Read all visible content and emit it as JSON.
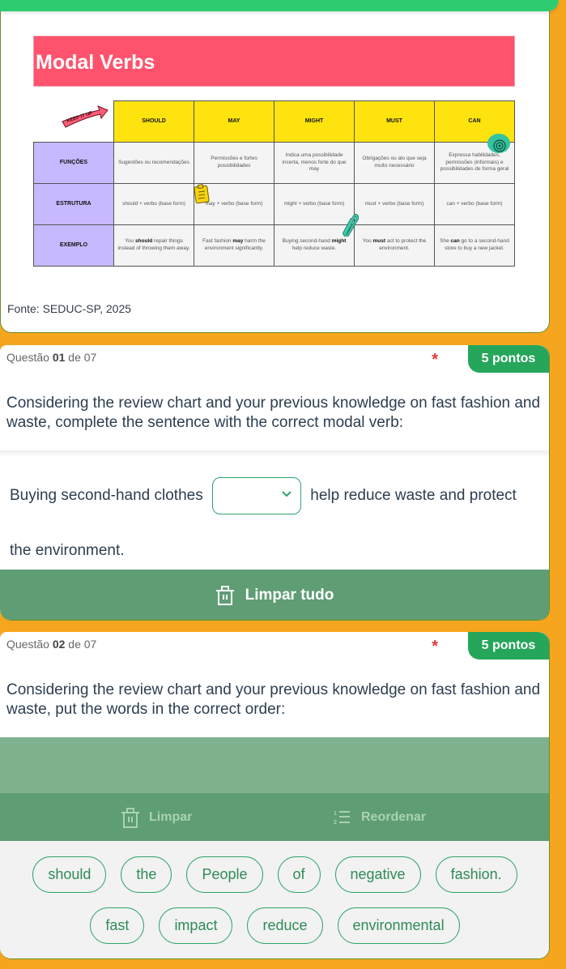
{
  "colors": {
    "page_bg": "#f5a61e",
    "top_bar": "#2ecc71",
    "banner": "#ff536d",
    "header_yellow": "#ffe30f",
    "row_header_purple": "#c8b8ff",
    "accent_green": "#26a65b",
    "button_green": "#5f9d74"
  },
  "review_card": {
    "banner_title": "Modal Verbs",
    "sticker_keep": "KEEP IT UP",
    "sticker_target": "ON TARGET",
    "table": {
      "columns": [
        "SHOULD",
        "MAY",
        "MIGHT",
        "MUST",
        "CAN"
      ],
      "rows": [
        {
          "label": "FUNÇÕES",
          "cells": [
            "Sugestões ou recomendações",
            "Permissões e fortes possibilidades",
            "Indica uma possibilidade incerta, menos forte do que may",
            "Obrigações ou alo que seja muito necessário",
            "Expressa habilidades, permissões (informais) e possibilidades de forma geral"
          ]
        },
        {
          "label": "ESTRUTURA",
          "cells": [
            "should + verbo (base form)",
            "may + verbo (base form)",
            "might + verbo (base form)",
            "must + verbo (base form)",
            "can + verbo (base form)"
          ]
        },
        {
          "label": "EXEMPLO",
          "cells": [
            {
              "pre": "You ",
              "modal": "should",
              "post": " repair things instead of throwing them away."
            },
            {
              "pre": "Fast fashion ",
              "modal": "may",
              "post": " harm the environment significantly."
            },
            {
              "pre": "Buying second-hand ",
              "modal": "might",
              "post": " help reduce waste."
            },
            {
              "pre": "You ",
              "modal": "must",
              "post": " act to protect the environment."
            },
            {
              "pre": "She ",
              "modal": "can",
              "post": " go to a second-hand store to buy a new jacket."
            }
          ]
        }
      ]
    },
    "source": "Fonte: SEDUC-SP, 2025"
  },
  "question1": {
    "label_prefix": "Questão ",
    "number": "01",
    "label_suffix": " de 07",
    "required_mark": "*",
    "points": "5 pontos",
    "prompt": "Considering the review chart and your previous knowledge on fast fashion and waste, complete the sentence with the correct modal verb:",
    "sentence_before": "Buying second-hand clothes",
    "select_value": "",
    "sentence_after": "help reduce waste and protect the environment.",
    "clear_all_label": "Limpar tudo"
  },
  "question2": {
    "label_prefix": "Questão ",
    "number": "02",
    "label_suffix": " de 07",
    "required_mark": "*",
    "points": "5 pontos",
    "prompt": "Considering the review chart and your previous knowledge on fast fashion and waste, put the words in the correct order:",
    "toolbar": {
      "clear_label": "Limpar",
      "reorder_label": "Reordenar"
    },
    "words_row1": [
      "should",
      "the",
      "People",
      "of",
      "negative",
      "fashion."
    ],
    "words_row2": [
      "fast",
      "impact",
      "reduce",
      "environmental"
    ]
  }
}
